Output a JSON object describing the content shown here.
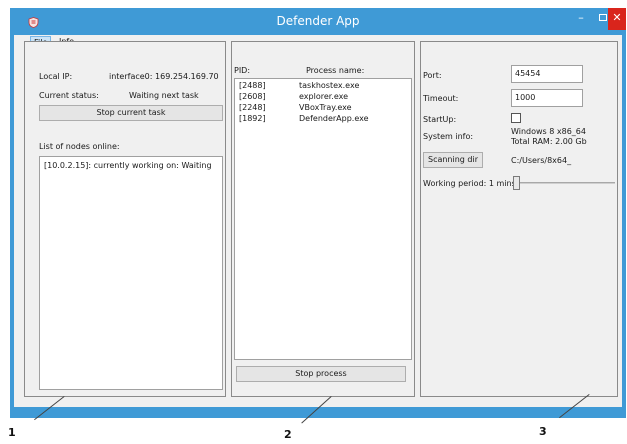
{
  "window": {
    "title": "Defender App",
    "controls": {
      "minimize": "–",
      "close": "✕"
    }
  },
  "menu": {
    "file": "File",
    "info": "Info"
  },
  "panel1": {
    "local_ip_label": "Local IP:",
    "local_ip_value": "interface0: 169.254.169.70",
    "status_label": "Current status:",
    "status_value": "Waiting next task",
    "stop_task_button": "Stop current task",
    "nodes_label": "List of nodes online:",
    "nodes": [
      "[10.0.2.15]: currently working on: Waiting"
    ]
  },
  "panel2": {
    "pid_header": "PID:",
    "name_header": "Process name:",
    "processes": [
      {
        "pid": "[2488]",
        "name": "taskhostex.exe"
      },
      {
        "pid": "[2608]",
        "name": "explorer.exe"
      },
      {
        "pid": "[2248]",
        "name": "VBoxTray.exe"
      },
      {
        "pid": "[1892]",
        "name": "DefenderApp.exe"
      }
    ],
    "stop_process_button": "Stop process"
  },
  "panel3": {
    "port_label": "Port:",
    "port_value": "45454",
    "timeout_label": "Timeout:",
    "timeout_value": "1000",
    "startup_label": "StartUp:",
    "startup_checked": false,
    "sysinfo_label": "System info:",
    "sysinfo_line1": "Windows 8 x86_64",
    "sysinfo_line2": "Total RAM: 2.00 Gb",
    "scan_button": "Scanning dir",
    "scan_path": "C:/Users/8x64_",
    "period_label": "Working period: 1 mins",
    "period_level": 0
  },
  "callouts": [
    "1",
    "2",
    "3"
  ],
  "colors": {
    "titlebar": "#3f9ad6",
    "close": "#d9251c"
  },
  "icons": {
    "app": "shield-icon"
  }
}
